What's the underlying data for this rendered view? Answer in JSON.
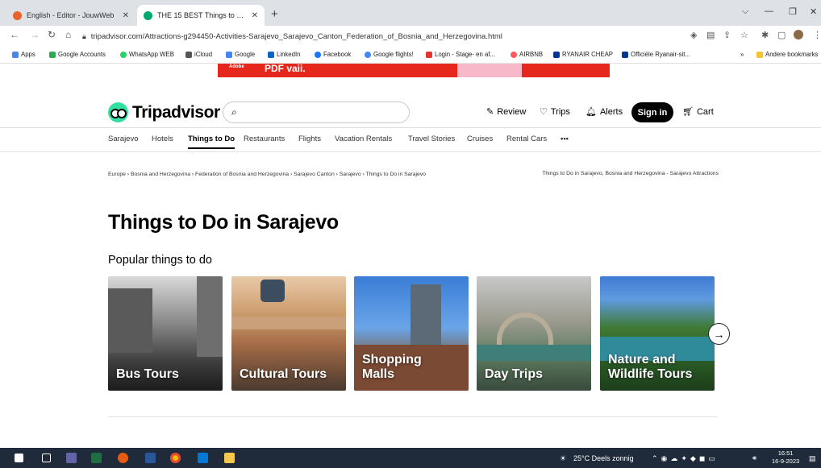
{
  "browser": {
    "tabs": [
      {
        "title": "English - Editor - JouwWeb",
        "active": false
      },
      {
        "title": "THE 15 BEST Things to Do in Sarajevo",
        "active": true
      }
    ],
    "url": "tripadvisor.com/Attractions-g294450-Activities-Sarajevo_Sarajevo_Canton_Federation_of_Bosnia_and_Herzegovina.html",
    "bookmarks": [
      "Apps",
      "Google Accounts",
      "WhatsApp WEB",
      "iCloud",
      "Google",
      "LinkedIn",
      "Facebook",
      "Google flights!",
      "Login - Stage- en af...",
      "AIRBNB",
      "RYANAIR CHEAP",
      "Officiële Ryanair-sit..."
    ],
    "bookmarks_more": "»",
    "other_bookmarks": "Andere bookmarks"
  },
  "ad": {
    "small": "Adobe",
    "big": "PDF vaii."
  },
  "header": {
    "logo": "Tripadvisor",
    "review": "Review",
    "trips": "Trips",
    "alerts": "Alerts",
    "signin": "Sign in",
    "cart": "Cart"
  },
  "subnav": [
    "Sarajevo",
    "Hotels",
    "Things to Do",
    "Restaurants",
    "Flights",
    "Vacation Rentals",
    "Travel Stories",
    "Cruises",
    "Rental Cars",
    "•••"
  ],
  "breadcrumb": {
    "left": "Europe › Bosnia and Herzegovina › Federation of Bosnia and Herzegovina › Sarajevo Canton › Sarajevo › Things to Do in Sarajevo",
    "right": "Things to Do in Sarajevo, Bosnia and Herzegovina - Sarajevo Attractions"
  },
  "page_title": "Things to Do in Sarajevo",
  "section_title": "Popular things to do",
  "cards": [
    {
      "label": "Bus Tours"
    },
    {
      "label": "Cultural Tours"
    },
    {
      "label": "Shopping Malls"
    },
    {
      "label": "Day Trips"
    },
    {
      "label": "Nature and Wildlife Tours"
    }
  ],
  "taskbar": {
    "weather": "25°C Deels zonnig",
    "time": "16:51",
    "date": "16-9-2023"
  }
}
